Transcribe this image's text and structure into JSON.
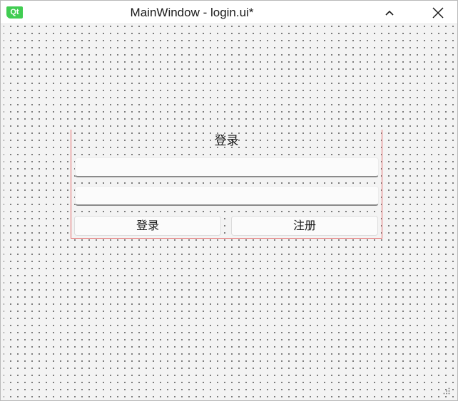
{
  "window": {
    "app_icon": "qt-logo",
    "app_icon_text": "Qt",
    "title": "MainWindow - login.ui*",
    "collapse_icon": "chevron-up-icon",
    "close_icon": "close-icon",
    "accent_color": "#41cd52"
  },
  "form": {
    "title_label": "登录",
    "username_value": "",
    "password_value": "",
    "login_button": "登录",
    "register_button": "注册",
    "selection_color": "#e36a6a"
  }
}
